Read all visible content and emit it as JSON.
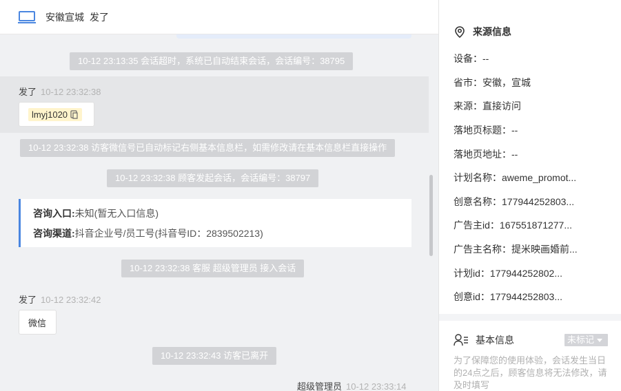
{
  "header": {
    "visitor_name": "安徽宣城",
    "visitor_status": "发了"
  },
  "chat": {
    "system_messages": [
      "10-12 23:13:35 会话超时，系统已自动结束会话，会话编号：38795",
      "10-12 23:32:38 访客微信号已自动标记右侧基本信息栏，如需修改请在基本信息栏直接操作",
      "10-12 23:32:38 顾客发起会话，会话编号：38797",
      "10-12 23:32:38 客服 超级管理员 接入会话",
      "10-12 23:32:43 访客已离开"
    ],
    "messages": [
      {
        "sender": "发了",
        "time": "10-12 23:32:38",
        "content": "lmyj1020"
      },
      {
        "sender": "发了",
        "time": "10-12 23:32:42",
        "content": "微信"
      }
    ],
    "agent_message": {
      "sender": "超级管理员",
      "time": "10-12 23:33:14"
    },
    "consult_card": {
      "entry_label": "咨询入口:",
      "entry_value": "未知(暂无入口信息)",
      "channel_label": "咨询渠道:",
      "channel_value": "抖音企业号/员工号(抖音号ID：2839502213)"
    }
  },
  "source_info": {
    "title": "来源信息",
    "items": [
      {
        "label": "设备：",
        "value": "--"
      },
      {
        "label": "省市：",
        "value": "安徽，宣城"
      },
      {
        "label": "来源：",
        "value": "直接访问"
      },
      {
        "label": "落地页标题：",
        "value": "--"
      },
      {
        "label": "落地页地址：",
        "value": "--"
      },
      {
        "label": "计划名称：",
        "value": "aweme_promot..."
      },
      {
        "label": "创意名称：",
        "value": "177944252803..."
      },
      {
        "label": "广告主id：",
        "value": "167551871277..."
      },
      {
        "label": "广告主名称：",
        "value": "提米映画婚前..."
      },
      {
        "label": "计划id：",
        "value": "177944252802..."
      },
      {
        "label": "创意id：",
        "value": "177944252803..."
      }
    ]
  },
  "basic_info": {
    "title": "基本信息",
    "mark_label": "未标记",
    "notice": "为了保障您的使用体验，会话发生当日的24点之后，顾客信息将无法修改，请及时填写"
  },
  "colors": {
    "accent": "#4a86e0",
    "system_bg": "#d2d3d6",
    "tag_bg": "#fff4cc"
  }
}
